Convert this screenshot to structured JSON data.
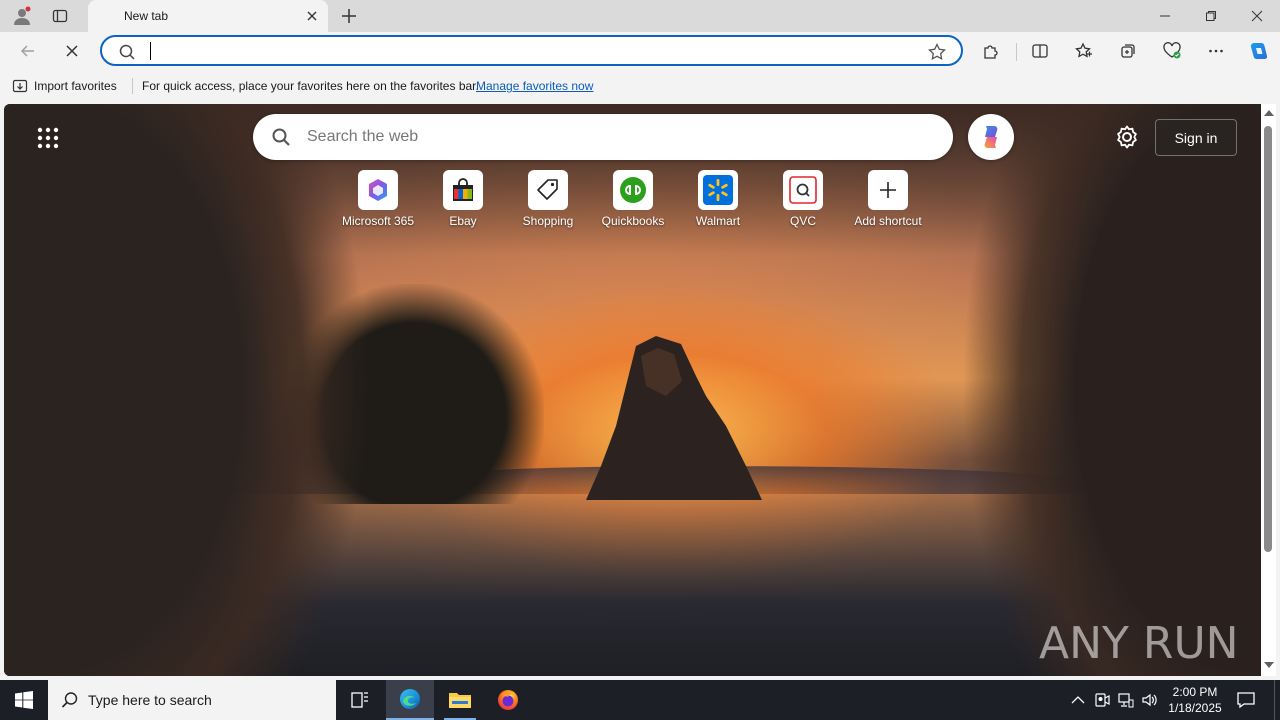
{
  "browser": {
    "tab": {
      "title": "New tab"
    },
    "address_bar": {
      "value": "",
      "placeholder": ""
    },
    "favorites_bar": {
      "import_label": "Import favorites",
      "message": "For quick access, place your favorites here on the favorites bar.",
      "manage_link": "Manage favorites now"
    }
  },
  "new_tab_page": {
    "search": {
      "placeholder": "Search the web"
    },
    "sign_in_label": "Sign in",
    "shortcuts": [
      {
        "label": "Microsoft 365",
        "icon": "microsoft-365-icon"
      },
      {
        "label": "Ebay",
        "icon": "ebay-bag-icon"
      },
      {
        "label": "Shopping",
        "icon": "shopping-tag-icon"
      },
      {
        "label": "Quickbooks",
        "icon": "quickbooks-icon"
      },
      {
        "label": "Walmart",
        "icon": "walmart-spark-icon"
      },
      {
        "label": "QVC",
        "icon": "qvc-icon"
      },
      {
        "label": "Add shortcut",
        "icon": "plus-icon"
      }
    ],
    "watermark": "ANY RUN"
  },
  "taskbar": {
    "search_placeholder": "Type here to search",
    "time": "2:00 PM",
    "date": "1/18/2025"
  },
  "colors": {
    "accent": "#0b63c6",
    "taskbar": "#1c1f26",
    "link": "#0b5cbe"
  }
}
